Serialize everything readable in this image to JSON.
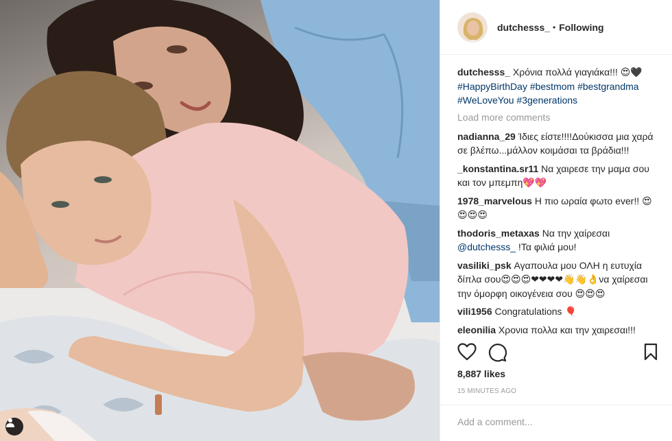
{
  "header": {
    "username": "dutchesss_",
    "separator": "•",
    "follow_state": "Following"
  },
  "caption": {
    "username": "dutchesss_",
    "text": " Χρόνια πολλά γιαγιάκα!!! 😍🖤",
    "hashtags": [
      "#HappyBirthDay",
      "#bestmom",
      "#bestgrandma",
      "#WeLoveYou",
      "#3generations"
    ]
  },
  "load_more": "Load more comments",
  "comments": [
    {
      "username": "nadianna_29",
      "text": " Ίδιες είστε!!!!Δούκισσα μια χαρά σε βλέπω...μάλλον κοιμάσαι τα βράδια!!!"
    },
    {
      "username": "_konstantina.sr11",
      "text": " Να χαιρεσε την μαμα σου και τον μπεμπη💖💖"
    },
    {
      "username": "1978_marvelous",
      "text": " Η πιο ωραία φωτο ever!! 😍😍😍😍"
    },
    {
      "username": "thodoris_metaxas",
      "text": " Να την χαίρεσαι ",
      "mention": "@dutchesss_",
      "text_after": " !Τα φιλιά μου!"
    },
    {
      "username": "vasiliki_psk",
      "text": " Αγαπουλα μου ΟΛΗ η ευτυχία δίπλα σου😍😍😍❤❤❤❤👋👋👌να χαίρεσαι την όμορφη οικογένεια σου 😍😍😍"
    },
    {
      "username": "vili1956",
      "text": " Congratulations 🎈"
    },
    {
      "username": "eleonilia",
      "text": " Χρονια πολλα και την χαιρεσαι!!!"
    }
  ],
  "icons": {
    "like": "heart-icon",
    "comment": "comment-icon",
    "save": "bookmark-icon",
    "tag": "user-tag-icon"
  },
  "likes_text": "8,887 likes",
  "timestamp": "15 MINUTES AGO",
  "add_comment": {
    "placeholder": "Add a comment..."
  },
  "colors": {
    "hashtag": "#003569",
    "muted": "#999999",
    "text": "#262626"
  }
}
